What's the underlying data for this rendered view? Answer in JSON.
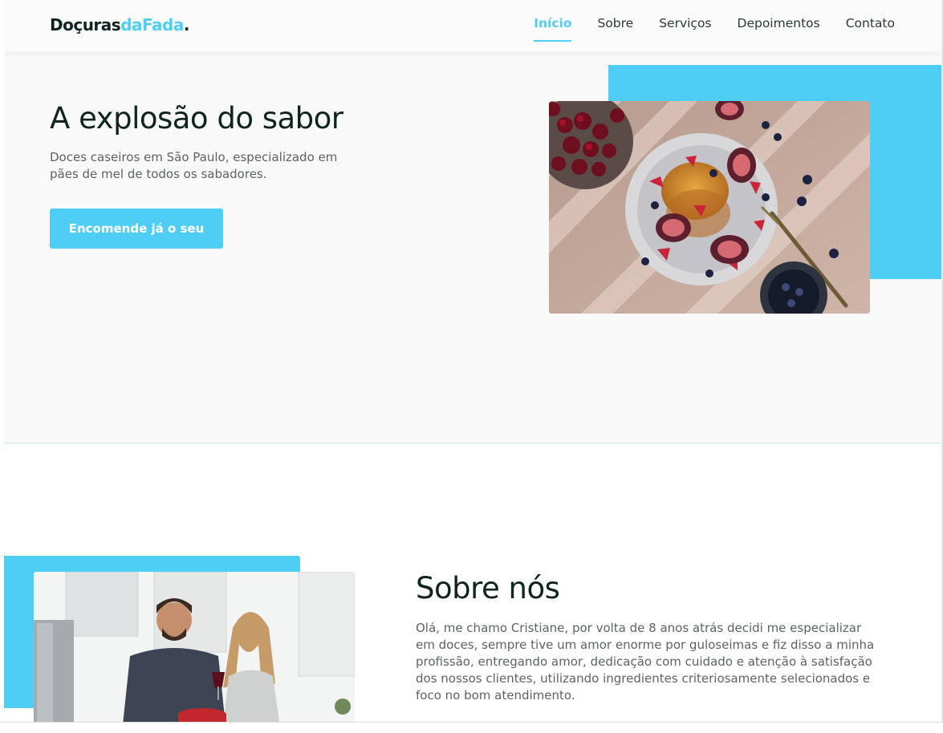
{
  "header": {
    "logo": {
      "part1": "Doçuras",
      "part2": "daFada",
      "part3": "."
    },
    "nav": [
      {
        "label": "Início",
        "active": true
      },
      {
        "label": "Sobre",
        "active": false
      },
      {
        "label": "Serviços",
        "active": false
      },
      {
        "label": "Depoimentos",
        "active": false
      },
      {
        "label": "Contato",
        "active": false
      }
    ]
  },
  "hero": {
    "title": "A explosão do sabor",
    "subtitle": "Doces caseiros em São Paulo, especializado em pães de mel de todos os sabadores.",
    "cta_label": "Encomende já o seu"
  },
  "about": {
    "title": "Sobre nós",
    "text": "Olá, me chamo Cristiane, por volta de 8 anos atrás decidi me especializar em doces, sempre tive um amor enorme por guloseimas e fiz disso a minha profissão, entregando amor, dedicação com cuidado e atenção à satisfação dos nossos clientes, utilizando ingredientes criteriosamente selecionados e foco no bom atendimento."
  },
  "colors": {
    "accent": "#4fcef5",
    "heading": "#0f2420",
    "body_text": "#5a6461",
    "background": "#f9f9f9"
  }
}
